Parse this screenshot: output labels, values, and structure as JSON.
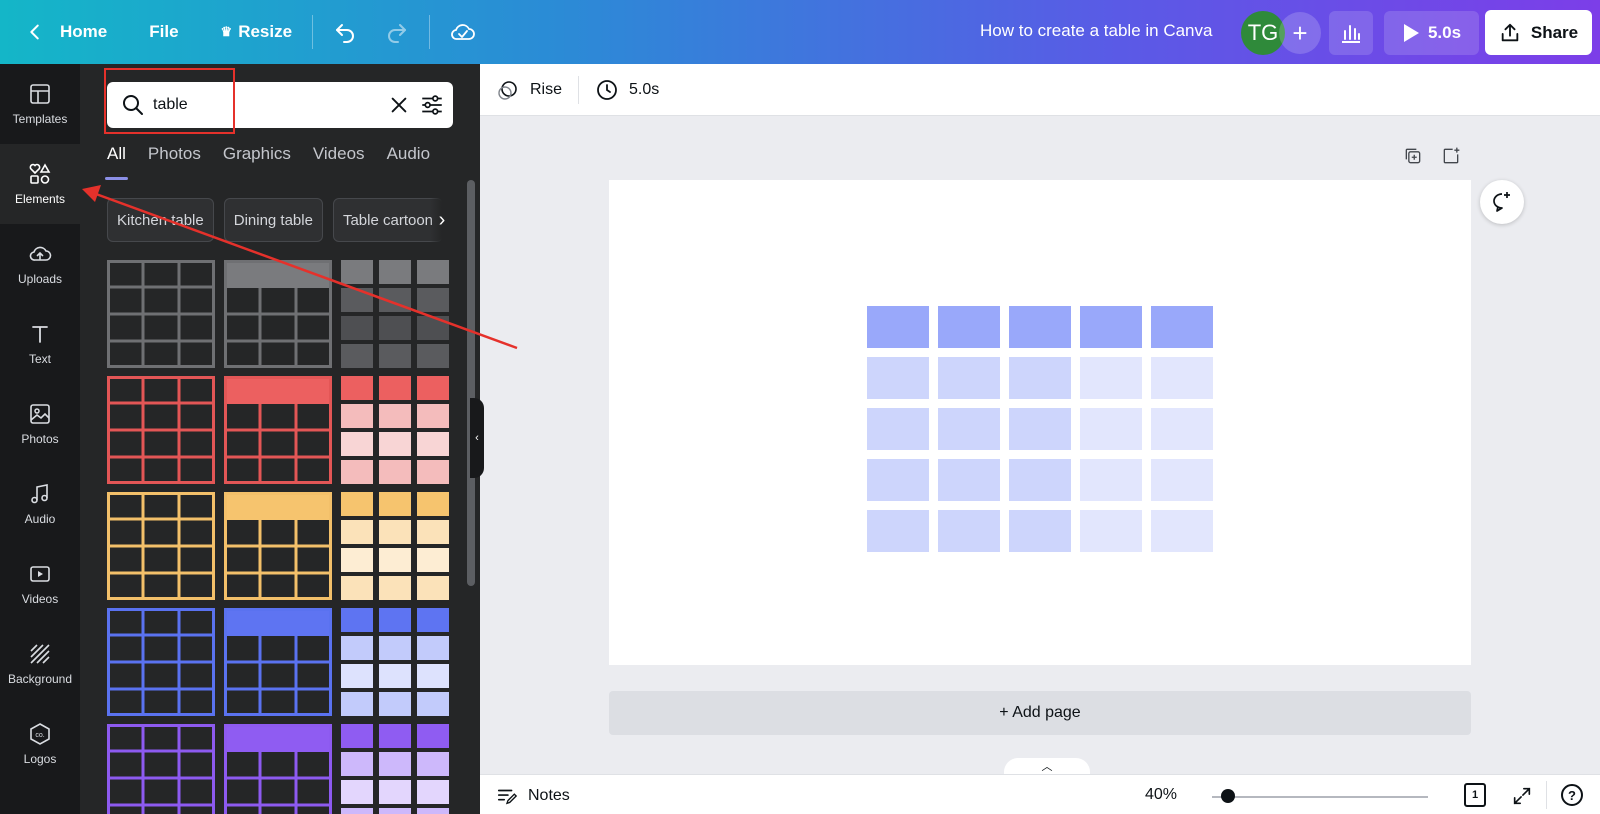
{
  "topbar": {
    "home": "Home",
    "file": "File",
    "resize": "Resize",
    "doc_title": "How to create a table in Canva",
    "avatar_initials": "TG",
    "play_time": "5.0s",
    "share": "Share"
  },
  "rail": {
    "items": [
      {
        "label": "Templates",
        "icon": "templates-icon"
      },
      {
        "label": "Elements",
        "icon": "elements-icon",
        "active": true
      },
      {
        "label": "Uploads",
        "icon": "upload-cloud-icon"
      },
      {
        "label": "Text",
        "icon": "text-icon"
      },
      {
        "label": "Photos",
        "icon": "image-icon"
      },
      {
        "label": "Audio",
        "icon": "music-note-icon"
      },
      {
        "label": "Videos",
        "icon": "video-icon"
      },
      {
        "label": "Background",
        "icon": "background-pattern-icon"
      },
      {
        "label": "Logos",
        "icon": "logo-icon"
      }
    ]
  },
  "panel": {
    "search_value": "table",
    "tabs": [
      "All",
      "Photos",
      "Graphics",
      "Videos",
      "Audio"
    ],
    "active_tab": "All",
    "chips": [
      "Kitchen table",
      "Dining table",
      "Table cartoon"
    ],
    "table_colors": [
      {
        "name": "gray",
        "line": "#6f7073",
        "header": "#7a7b7e",
        "light": "#5a5b5e",
        "lighter": "#4e4f52"
      },
      {
        "name": "red",
        "line": "#e35656",
        "header": "#ec6060",
        "light": "#f4bcbc",
        "lighter": "#f8d5d5"
      },
      {
        "name": "yellow",
        "line": "#f3c06a",
        "header": "#f6c46e",
        "light": "#fbe2b9",
        "lighter": "#fdedd3"
      },
      {
        "name": "blue",
        "line": "#5a72f0",
        "header": "#5e74f2",
        "light": "#c2cbfb",
        "lighter": "#dde2fd"
      },
      {
        "name": "purple",
        "line": "#8d5af0",
        "header": "#8f5cf2",
        "light": "#cdb8fb",
        "lighter": "#e3d6fd"
      }
    ]
  },
  "editor": {
    "animation": "Rise",
    "duration": "5.0s",
    "add_page": "+ Add page",
    "canvas_colors": {
      "header": "#99a8fa",
      "body": "#cdd5fc",
      "body_light": "#e2e6fd"
    }
  },
  "footer": {
    "notes": "Notes",
    "zoom": "40%",
    "zoom_fraction": 0.04,
    "page_count": "1",
    "help": "?"
  },
  "accent": {
    "annotation_red": "#e5312b"
  }
}
